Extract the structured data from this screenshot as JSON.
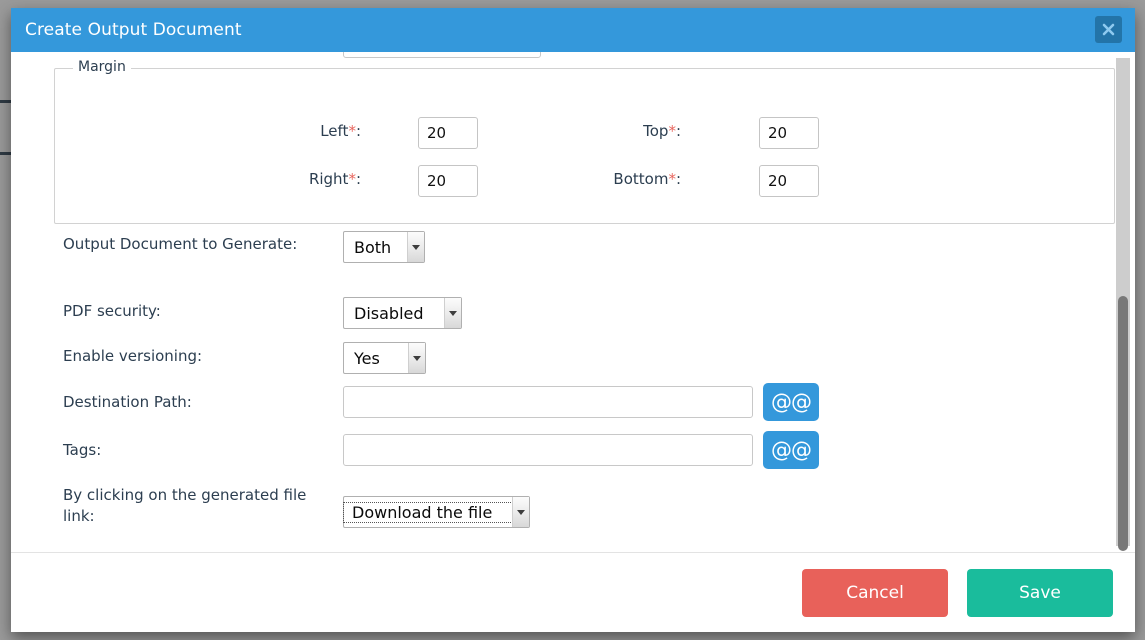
{
  "modal": {
    "title": "Create Output Document",
    "close_icon": "close-icon"
  },
  "margin_section": {
    "legend": "Margin",
    "fields": [
      {
        "label": "Left",
        "required": true,
        "value": "20"
      },
      {
        "label": "Top",
        "required": true,
        "value": "20"
      },
      {
        "label": "Right",
        "required": true,
        "value": "20"
      },
      {
        "label": "Bottom",
        "required": true,
        "value": "20"
      }
    ],
    "required_marker": "*",
    "colon": ":"
  },
  "form": {
    "rows": [
      {
        "label": "Output Document to Generate:",
        "control": "select",
        "value": "Both",
        "options": [
          "Both"
        ]
      },
      {
        "label": "PDF security:",
        "control": "select",
        "value": "Disabled",
        "options": [
          "Disabled"
        ]
      },
      {
        "label": "Enable versioning:",
        "control": "select",
        "value": "Yes",
        "options": [
          "Yes"
        ]
      },
      {
        "label": "Destination Path:",
        "control": "text",
        "value": "",
        "placeholder": "",
        "side_button": "@@"
      },
      {
        "label": "Tags:",
        "control": "text",
        "value": "",
        "placeholder": "",
        "side_button": "@@"
      },
      {
        "label": "By clicking on the generated file link:",
        "control": "select",
        "value": "Download the file",
        "options": [
          "Download the file"
        ],
        "focused": true
      }
    ]
  },
  "footer": {
    "cancel_label": "Cancel",
    "save_label": "Save"
  },
  "colors": {
    "header_blue": "#3498db",
    "close_blue": "#2374a8",
    "accent_blue": "#3498db",
    "cancel_red": "#e8615a",
    "save_green": "#1abc9c",
    "label_text": "#2c3e50",
    "required_star": "#e8665e",
    "backdrop": "#9a9a9a"
  }
}
